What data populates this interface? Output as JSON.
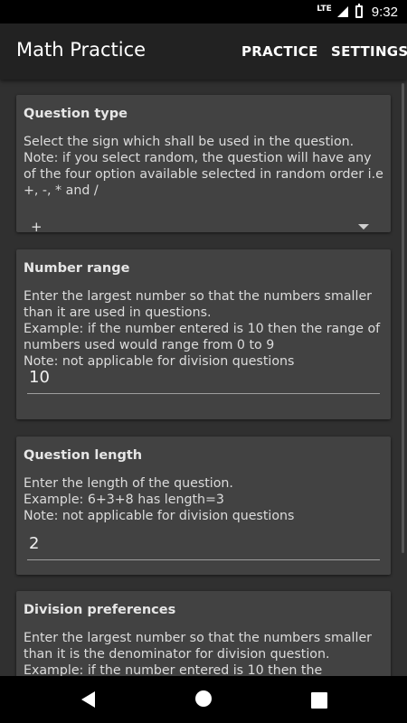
{
  "status_bar": {
    "network": "LTE",
    "time": "9:32"
  },
  "app_bar": {
    "title": "Math Practice",
    "actions": [
      "PRACTICE",
      "SETTINGS"
    ]
  },
  "settings": {
    "question_type": {
      "title": "Question type",
      "description": "Select the sign which shall be used in the question.\nNote: if you select random, the question will have any of the four option available selected in random order i.e +, -, * and /",
      "selected": "+"
    },
    "number_range": {
      "title": "Number range",
      "description": "Enter the largest number so that the numbers smaller than it are used in questions.\nExample: if the number entered is 10 then the range of numbers used would range from 0 to 9\nNote: not applicable for division questions",
      "value": "10"
    },
    "question_length": {
      "title": "Question length",
      "description": "Enter the length of the question.\nExample: 6+3+8 has length=3\nNote: not applicable for division questions",
      "value": "2"
    },
    "division_preferences": {
      "title": "Division preferences",
      "description": "Enter the largest number so that the numbers smaller than it is the denominator for division question.\nExample: if the number entered is 10 then the"
    }
  },
  "colors": {
    "background": "#303030",
    "card": "#424242",
    "app_bar": "#222222"
  }
}
